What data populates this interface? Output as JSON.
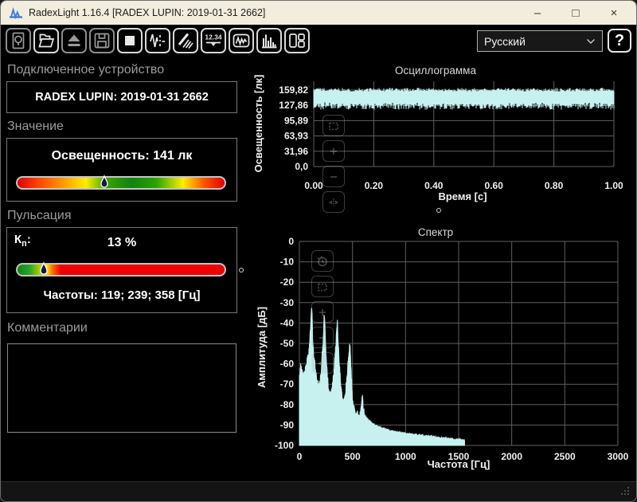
{
  "window": {
    "title": "RadexLight 1.16.4 [RADEX LUPIN: 2019-01-31 2662]",
    "minimize": "–",
    "maximize": "□",
    "close": "×"
  },
  "toolbar": {
    "buttons": [
      {
        "name": "preview",
        "enabled": false
      },
      {
        "name": "open-file",
        "enabled": true
      },
      {
        "name": "read-device",
        "enabled": false
      },
      {
        "name": "save",
        "enabled": false
      },
      {
        "name": "stop",
        "enabled": true
      },
      {
        "name": "signal-settings",
        "enabled": true
      },
      {
        "name": "sweep",
        "enabled": true
      },
      {
        "name": "digital-display",
        "enabled": true,
        "text": "12.34"
      },
      {
        "name": "oscillogram-view",
        "enabled": true
      },
      {
        "name": "spectrum-view",
        "enabled": true
      },
      {
        "name": "layout-view",
        "enabled": true
      }
    ],
    "language_value": "Русский",
    "help_label": "?"
  },
  "left_panel": {
    "device": {
      "header": "Подключенное устройство",
      "name": "RADEX LUPIN: 2019-01-31 2662"
    },
    "value": {
      "header": "Значение",
      "reading": "Освещенность: 141 лк",
      "marker_percent": 42,
      "gradient": [
        "#dd0000 0%",
        "#ff4400 10%",
        "#ff9900 22%",
        "#ffee00 33%",
        "#3aa400 43%",
        "#128112 55%",
        "#2aa400 67%",
        "#ffee00 80%",
        "#ff5500 90%",
        "#dd0000 100%"
      ]
    },
    "pulsation": {
      "header": "Пульсация",
      "kp": {
        "base": "К",
        "sub": "п",
        "colon": ":"
      },
      "value": "13 %",
      "marker_percent": 12.5,
      "frequencies": "Частоты: 119; 239; 358 [Гц]",
      "gradient": [
        "#0e8410 0%",
        "#2aa42a 6%",
        "#9ac800 10%",
        "#ffee00 14%",
        "#ff6600 17%",
        "#ee0000 21%",
        "#ee0000 100%"
      ]
    },
    "comments": {
      "header": "Комментарии",
      "text": ""
    }
  },
  "chart_controls": {
    "osc": [
      "zoom-box",
      "zoom-in",
      "zoom-out",
      "zoom-fit"
    ],
    "spectrum": [
      "history",
      "zoom-box",
      "zoom-in",
      "zoom-out",
      "zoom-fit"
    ]
  },
  "chart_data": [
    {
      "type": "line",
      "title": "Осциллограмма",
      "xlabel": "Время [с]",
      "ylabel": "Освещенность [лк]",
      "x_ticks": [
        "0.00",
        "0.20",
        "0.40",
        "0.60",
        "0.80",
        "1.00"
      ],
      "x_tick_values": [
        0,
        0.2,
        0.4,
        0.6,
        0.8,
        1.0
      ],
      "y_ticks": [
        "159,82",
        "127,86",
        "95,89",
        "63,93",
        "31,96",
        "0,0"
      ],
      "y_tick_values": [
        159.82,
        127.86,
        95.89,
        63.93,
        31.96,
        0
      ],
      "xlim": [
        0,
        1
      ],
      "ylim": [
        0,
        178
      ],
      "grid": true,
      "legend": "none",
      "color": "#c6f1ee",
      "series": [
        {
          "name": "illuminance-flicker",
          "kind": "dense-band",
          "mean_lux": 141,
          "band_top_lux": 162,
          "band_top_jitter": 5,
          "band_bottom_lux": 119,
          "band_bottom_jitter": 12
        }
      ]
    },
    {
      "type": "area",
      "title": "Спектр",
      "xlabel": "Частота [Гц]",
      "ylabel": "Амплитуда [дБ]",
      "x_ticks": [
        "0",
        "500",
        "1000",
        "1500",
        "2000",
        "2500",
        "3000"
      ],
      "x_tick_values": [
        0,
        500,
        1000,
        1500,
        2000,
        2500,
        3000
      ],
      "y_ticks": [
        "0",
        "-10",
        "-20",
        "-30",
        "-40",
        "-50",
        "-60",
        "-70",
        "-80",
        "-90",
        "-100"
      ],
      "y_tick_values": [
        0,
        -10,
        -20,
        -30,
        -40,
        -50,
        -60,
        -70,
        -80,
        -90,
        -100
      ],
      "xlim": [
        0,
        3000
      ],
      "ylim": [
        -100,
        0
      ],
      "grid": true,
      "legend": "none",
      "color": "#c6f1ee",
      "main_peaks_hz": [
        119,
        239,
        358
      ],
      "minor_peaks_hz": [
        477,
        597
      ],
      "signal_end_hz": 1556,
      "noise_jitter_db": 2.6,
      "envelope_points": [
        [
          0,
          -66
        ],
        [
          10,
          -62
        ],
        [
          25,
          -64
        ],
        [
          40,
          -66
        ],
        [
          55,
          -64
        ],
        [
          70,
          -60
        ],
        [
          85,
          -56
        ],
        [
          100,
          -48
        ],
        [
          113,
          -33
        ],
        [
          119,
          -34
        ],
        [
          126,
          -48
        ],
        [
          140,
          -58
        ],
        [
          155,
          -65
        ],
        [
          170,
          -70
        ],
        [
          185,
          -71
        ],
        [
          200,
          -67
        ],
        [
          212,
          -58
        ],
        [
          225,
          -48
        ],
        [
          233,
          -35
        ],
        [
          242,
          -42
        ],
        [
          252,
          -56
        ],
        [
          265,
          -68
        ],
        [
          280,
          -74
        ],
        [
          295,
          -76
        ],
        [
          310,
          -72
        ],
        [
          325,
          -64
        ],
        [
          340,
          -54
        ],
        [
          352,
          -43
        ],
        [
          358,
          -39
        ],
        [
          366,
          -50
        ],
        [
          378,
          -62
        ],
        [
          392,
          -72
        ],
        [
          405,
          -78
        ],
        [
          418,
          -80
        ],
        [
          432,
          -76
        ],
        [
          445,
          -68
        ],
        [
          458,
          -60
        ],
        [
          468,
          -54
        ],
        [
          477,
          -51
        ],
        [
          486,
          -62
        ],
        [
          495,
          -74
        ],
        [
          505,
          -80
        ],
        [
          520,
          -84
        ],
        [
          540,
          -85
        ],
        [
          558,
          -86
        ],
        [
          575,
          -85
        ],
        [
          588,
          -80
        ],
        [
          595,
          -75
        ],
        [
          602,
          -82
        ],
        [
          612,
          -85
        ],
        [
          620,
          -86
        ],
        [
          660,
          -88
        ],
        [
          700,
          -90
        ],
        [
          800,
          -92
        ],
        [
          900,
          -93.5
        ],
        [
          1000,
          -94.3
        ],
        [
          1100,
          -94.9
        ],
        [
          1200,
          -95.5
        ],
        [
          1300,
          -96.2
        ],
        [
          1400,
          -96.8
        ],
        [
          1500,
          -97.3
        ],
        [
          1556,
          -97.6
        ]
      ]
    }
  ]
}
